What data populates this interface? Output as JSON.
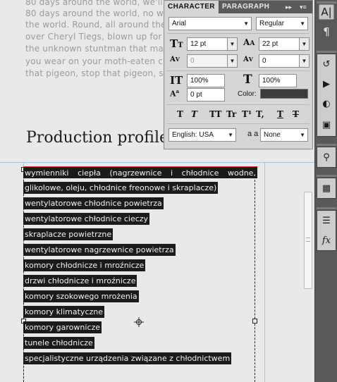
{
  "background_text": [
    "80 days around the world, we'll find",
    "80 days around the world, no we won't",
    "the world. Round, all around the world",
    "over Cheryl Tiegs, blown up for Rac",
    "the unknown stuntman that makes",
    "you wear on your moth-eaten ches",
    "that pigeon, stop that pigeon, stop"
  ],
  "heading": "Production profile",
  "selected_text": {
    "first_line_words": [
      "wymienniki",
      "ciepła",
      "(nagrzewnice",
      "i",
      "chłodnice",
      "wodne,"
    ],
    "lines": [
      "glikolowe, oleju, chłodnice freonowe i skraplacze)",
      "wentylatorowe chłodnice powietrza",
      "wentylatorowe chłodnice cieczy",
      "skraplacze powietrzne",
      "wentylatorowe nagrzewnice powietrza",
      "komory chłodnicze i mroźnicze",
      "drzwi chłodnicze i mroźnicze",
      "komory szokowego mrożenia",
      "komory klimatyczne",
      "komory garownicze",
      "tunele chłodnicze",
      "specjalistyczne urządzenia związane z chłodnictwem"
    ]
  },
  "panel": {
    "tabs": [
      "CHARACTER",
      "PARAGRAPH"
    ],
    "collapse_glyph": "▸▸",
    "menu_glyph": "▾≡",
    "font_family": "Arial",
    "font_style": "Regular",
    "font_size": "12 pt",
    "leading": "22 pt",
    "kerning": "0",
    "tracking": "0",
    "vertical_scale": "100%",
    "horizontal_scale": "100%",
    "baseline_shift": "0 pt",
    "color_label": "Color:",
    "text_color": "#3b3b3b",
    "style_buttons": [
      "T",
      "T",
      "TT",
      "Tr",
      "T¹",
      "T,",
      "T",
      "T"
    ],
    "language": "English: USA",
    "aa_label": "a a",
    "antialias": "None"
  },
  "toolbar": {
    "icons": [
      "character-icon",
      "paragraph-icon",
      "history-icon",
      "actions-icon",
      "styles-icon",
      "masks-icon",
      "tool-presets-icon",
      "swatches-icon",
      "layer-comps-icon",
      "layer-effects-icon"
    ]
  }
}
